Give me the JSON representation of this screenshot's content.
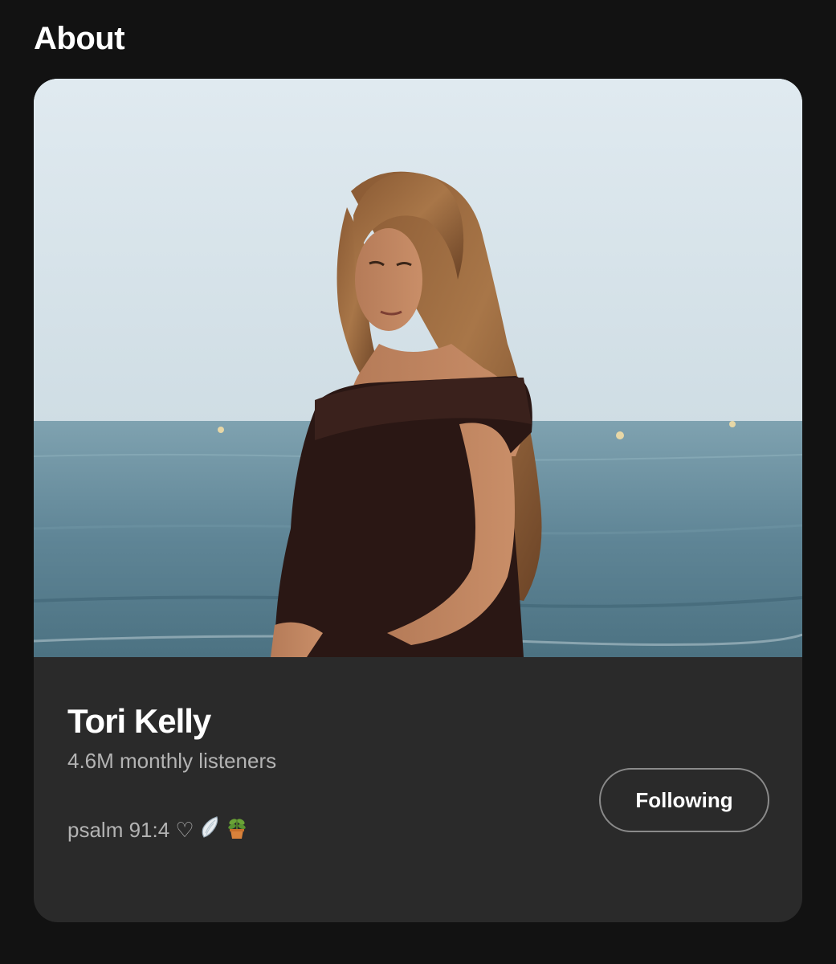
{
  "section": {
    "title": "About"
  },
  "artist": {
    "name": "Tori Kelly",
    "monthly_listeners": "4.6M monthly listeners",
    "bio_text": "psalm 91:4 ♡",
    "photo_alt": "Tori Kelly"
  },
  "follow_button": {
    "label": "Following"
  },
  "icons": {
    "bio_icons": [
      "wing-icon",
      "potted-plant-icon"
    ]
  },
  "colors": {
    "background": "#121212",
    "card": "#2a2a2a",
    "primary_text": "#ffffff",
    "secondary_text": "#b3b3b3",
    "button_border": "#8a8a8a"
  }
}
